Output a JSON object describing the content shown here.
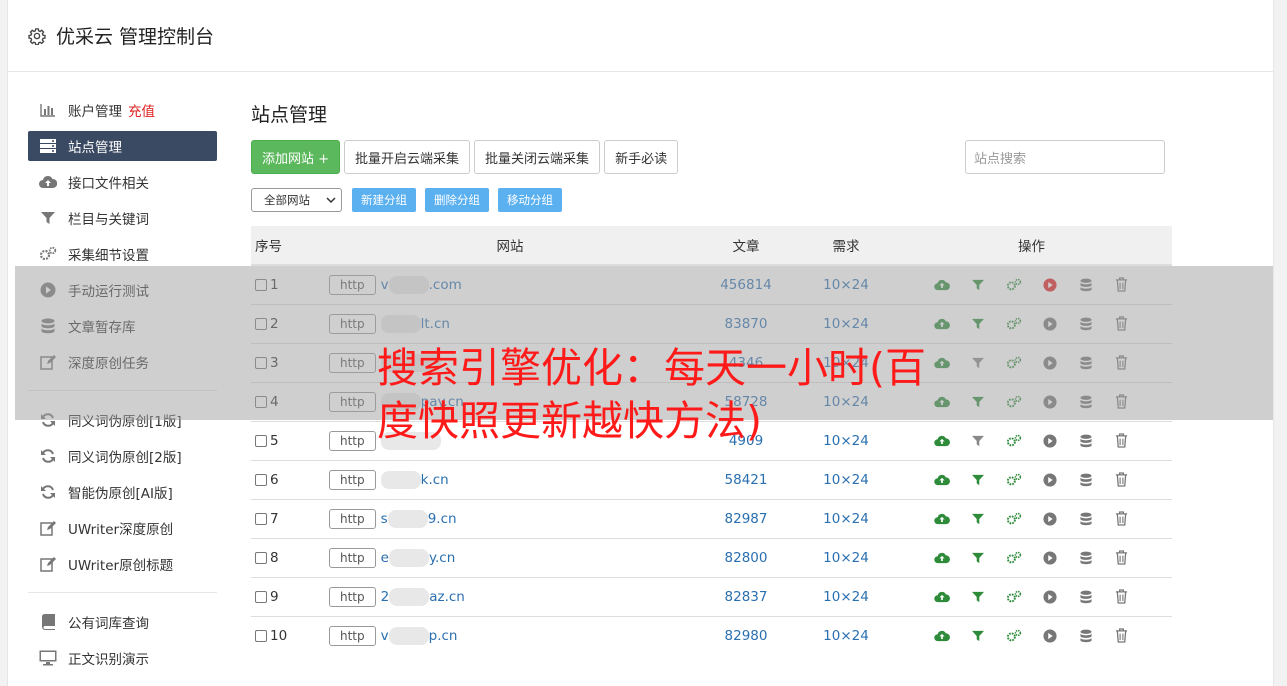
{
  "header": {
    "title": "优采云 管理控制台"
  },
  "sidebar": {
    "items": [
      {
        "label": "账户管理",
        "extra": "充值",
        "icon": "bar-chart-icon"
      },
      {
        "label": "站点管理",
        "icon": "server-icon",
        "active": true
      },
      {
        "label": "接口文件相关",
        "icon": "cloud-upload-icon"
      },
      {
        "label": "栏目与关键词",
        "icon": "filter-icon"
      },
      {
        "label": "采集细节设置",
        "icon": "gears-icon"
      },
      {
        "label": "手动运行测试",
        "icon": "play-circle-icon"
      },
      {
        "label": "文章暂存库",
        "icon": "database-icon"
      },
      {
        "label": "深度原创任务",
        "icon": "edit-icon"
      }
    ],
    "items2": [
      {
        "label": "同义词伪原创[1版]",
        "icon": "refresh-icon"
      },
      {
        "label": "同义词伪原创[2版]",
        "icon": "refresh-icon"
      },
      {
        "label": "智能伪原创[AI版]",
        "icon": "refresh-icon"
      },
      {
        "label": "UWriter深度原创",
        "icon": "edit-icon"
      },
      {
        "label": "UWriter原创标题",
        "icon": "edit-icon"
      }
    ],
    "items3": [
      {
        "label": "公有词库查询",
        "icon": "book-icon"
      },
      {
        "label": "正文识别演示",
        "icon": "monitor-icon"
      }
    ]
  },
  "main": {
    "title": "站点管理",
    "buttons": {
      "add": "添加网站 +",
      "batch_on": "批量开启云端采集",
      "batch_off": "批量关闭云端采集",
      "guide": "新手必读"
    },
    "search_placeholder": "站点搜索",
    "group_select": "全部网站",
    "group_buttons": {
      "new": "新建分组",
      "delete": "删除分组",
      "move": "移动分组"
    },
    "table": {
      "headers": {
        "no": "序号",
        "site": "网站",
        "articles": "文章",
        "need": "需求",
        "ops": "操作"
      },
      "http_label": "http",
      "rows": [
        {
          "no": "1",
          "pre": "v",
          "site": ".com",
          "articles": "456814",
          "need": "10×24",
          "filter_on": true,
          "play_red": true
        },
        {
          "no": "2",
          "pre": "",
          "site": "lt.cn",
          "articles": "83870",
          "need": "10×24",
          "filter_on": true,
          "play_red": false
        },
        {
          "no": "3",
          "pre": "",
          "site": "",
          "articles": "4346",
          "need": "10×24",
          "filter_on": false,
          "play_red": false
        },
        {
          "no": "4",
          "pre": "",
          "site": "pay.cn",
          "articles": "58728",
          "need": "10×24",
          "filter_on": true,
          "play_red": false
        },
        {
          "no": "5",
          "pre": "",
          "site": "",
          "articles": "4909",
          "need": "10×24",
          "filter_on": false,
          "play_red": false
        },
        {
          "no": "6",
          "pre": "",
          "site": "k.cn",
          "articles": "58421",
          "need": "10×24",
          "filter_on": true,
          "play_red": false
        },
        {
          "no": "7",
          "pre": "s",
          "site": "9.cn",
          "articles": "82987",
          "need": "10×24",
          "filter_on": true,
          "play_red": false
        },
        {
          "no": "8",
          "pre": "e",
          "site": "y.cn",
          "articles": "82800",
          "need": "10×24",
          "filter_on": true,
          "play_red": false
        },
        {
          "no": "9",
          "pre": "2",
          "site": "az.cn",
          "articles": "82837",
          "need": "10×24",
          "filter_on": true,
          "play_red": false
        },
        {
          "no": "10",
          "pre": "v",
          "site": "p.cn",
          "articles": "82980",
          "need": "10×24",
          "filter_on": true,
          "play_red": false
        }
      ]
    }
  },
  "overlay": {
    "headline": "搜索引擎优化：每天一小时(百度快照更新越快方法)"
  },
  "colors": {
    "sidebar_active": "#3b4a63",
    "green": "#5cb85c",
    "blue_button": "#5bb0f0",
    "link": "#2a6fb0",
    "accent_red": "#e02020"
  }
}
